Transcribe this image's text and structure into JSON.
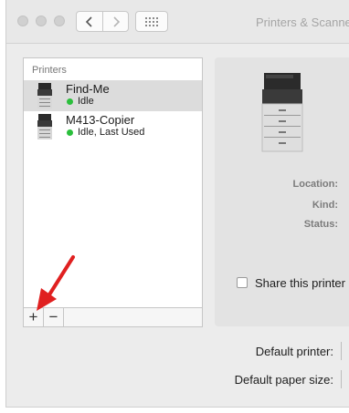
{
  "window": {
    "title": "Printers & Scanners"
  },
  "printers_list": {
    "header": "Printers",
    "items": [
      {
        "name": "Find-Me",
        "status": "Idle",
        "selected": true
      },
      {
        "name": "M413-Copier",
        "status": "Idle, Last Used",
        "selected": false
      }
    ],
    "add_label": "+",
    "remove_label": "−"
  },
  "details": {
    "location_label": "Location:",
    "kind_label": "Kind:",
    "status_label": "Status:",
    "share_label": "Share this printer on the network"
  },
  "footer": {
    "default_printer_label": "Default printer:",
    "default_paper_label": "Default paper size:"
  },
  "colors": {
    "status_idle": "#2bbf3c",
    "annotation_arrow": "#e02020"
  }
}
